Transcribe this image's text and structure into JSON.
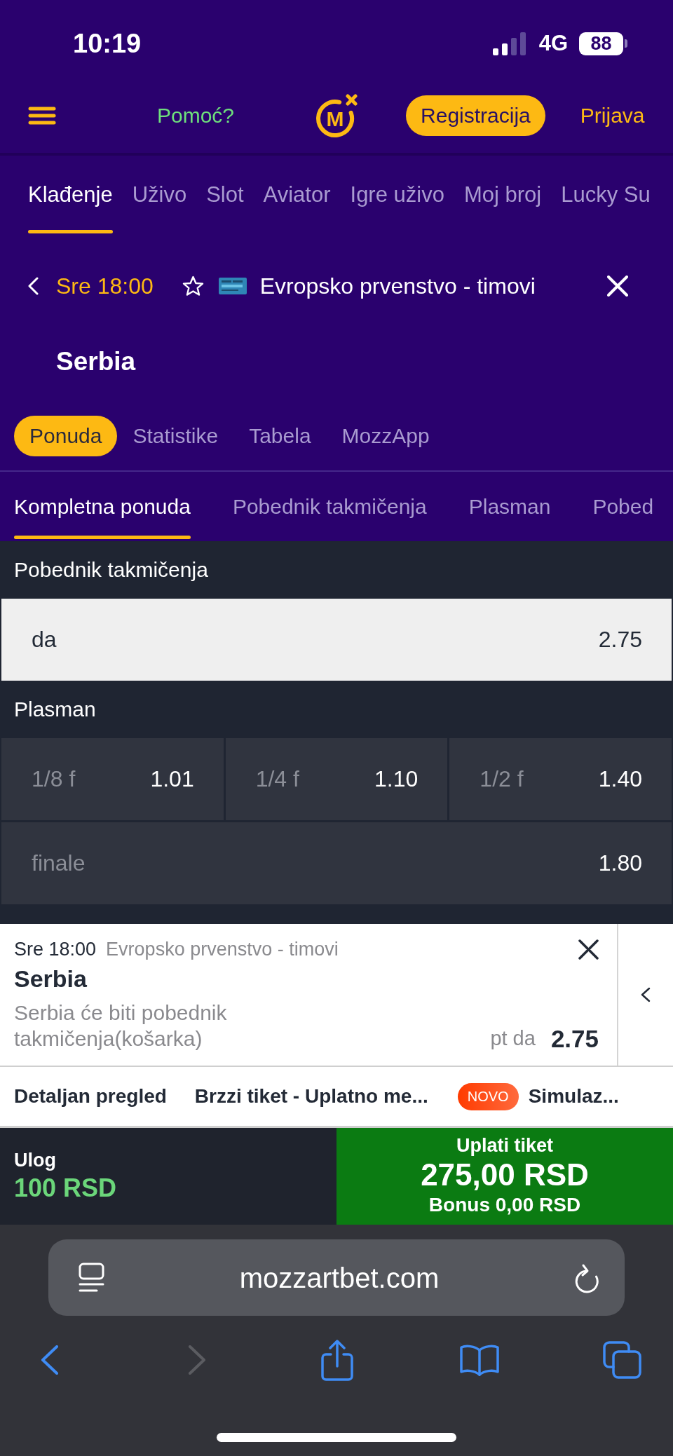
{
  "status_bar": {
    "time": "10:19",
    "network": "4G",
    "battery": "88"
  },
  "header": {
    "help_link": "Pomoć?",
    "logo_text": "M",
    "register_button": "Registracija",
    "login_link": "Prijava"
  },
  "nav_tabs": [
    {
      "label": "Klađenje",
      "selected": true
    },
    {
      "label": "Uživo",
      "selected": false
    },
    {
      "label": "Slot",
      "selected": false
    },
    {
      "label": "Aviator",
      "selected": false
    },
    {
      "label": "Igre uživo",
      "selected": false
    },
    {
      "label": "Moj broj",
      "selected": false
    },
    {
      "label": "Lucky Su",
      "selected": false
    }
  ],
  "match_header": {
    "time": "Sre 18:00",
    "competition": "Evropsko prvenstvo - timovi",
    "team": "Serbia"
  },
  "view_tabs": [
    {
      "label": "Ponuda",
      "selected": true
    },
    {
      "label": "Statistike",
      "selected": false
    },
    {
      "label": "Tabela",
      "selected": false
    },
    {
      "label": "MozzApp",
      "selected": false
    }
  ],
  "market_tabs": [
    {
      "label": "Kompletna ponuda",
      "selected": true
    },
    {
      "label": "Pobednik takmičenja",
      "selected": false
    },
    {
      "label": "Plasman",
      "selected": false
    },
    {
      "label": "Pobed",
      "selected": false
    }
  ],
  "markets": [
    {
      "title": "Pobednik takmičenja",
      "rows": [
        {
          "cells": [
            {
              "label": "da",
              "odds": "2.75",
              "selected": true
            }
          ]
        }
      ]
    },
    {
      "title": "Plasman",
      "rows": [
        {
          "cells": [
            {
              "label": "1/8 f",
              "odds": "1.01",
              "selected": false
            },
            {
              "label": "1/4 f",
              "odds": "1.10",
              "selected": false
            },
            {
              "label": "1/2 f",
              "odds": "1.40",
              "selected": false
            }
          ]
        },
        {
          "cells": [
            {
              "label": "finale",
              "odds": "1.80",
              "selected": false
            }
          ]
        }
      ]
    }
  ],
  "bet_slip": {
    "time": "Sre 18:00",
    "competition": "Evropsko prvenstvo - timovi",
    "team": "Serbia",
    "description": "Serbia će biti pobednik takmičenja(košarka)",
    "pick": "pt da",
    "odds": "2.75"
  },
  "slip_options": [
    {
      "label": "Detaljan pregled"
    },
    {
      "label": "Brzzi tiket - Uplatno me..."
    },
    {
      "label": "Simulaz...",
      "badge": "NOVO"
    }
  ],
  "stake": {
    "label": "Ulog",
    "amount": "100 RSD"
  },
  "pay_button": {
    "label": "Uplati tiket",
    "amount": "275,00 RSD",
    "bonus": "Bonus 0,00 RSD"
  },
  "browser": {
    "url": "mozzartbet.com",
    "forward_disabled": true
  }
}
